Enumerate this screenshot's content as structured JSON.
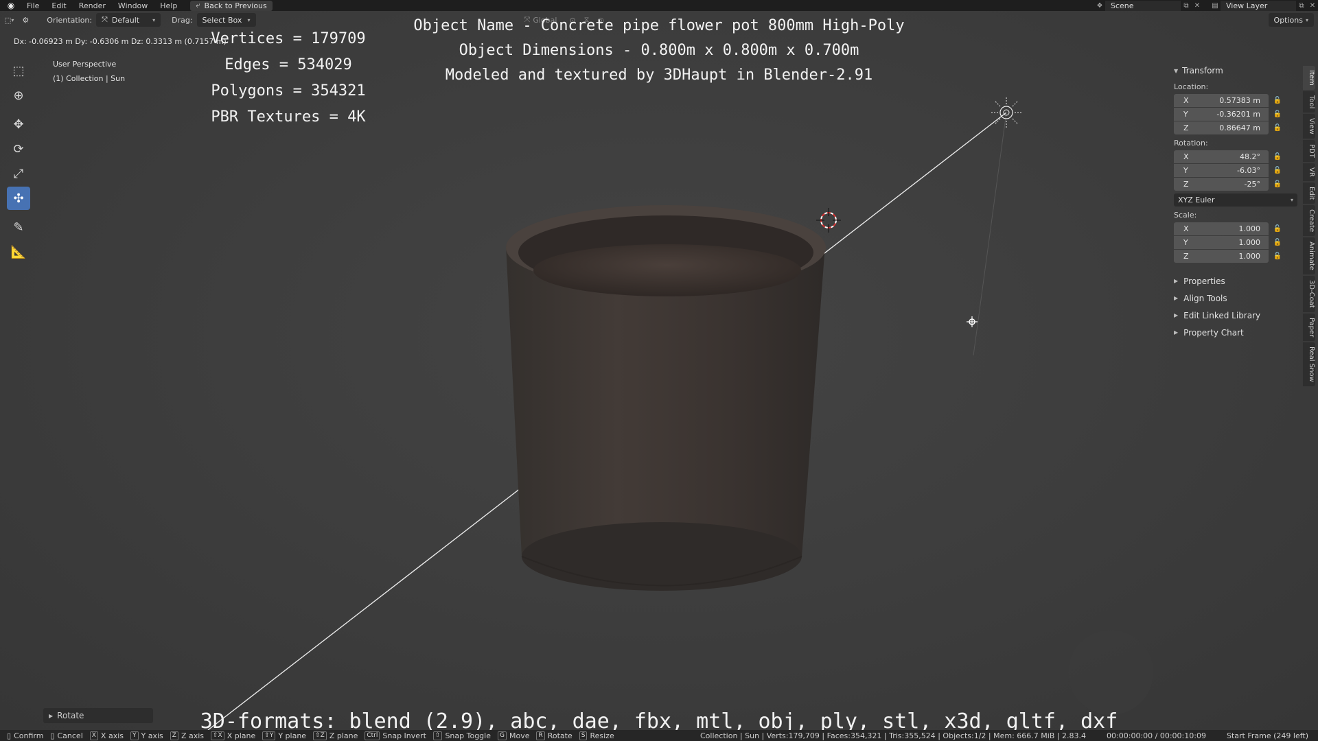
{
  "menubar": {
    "items": [
      "File",
      "Edit",
      "Render",
      "Window",
      "Help"
    ],
    "back_label": "Back to Previous",
    "scene_label": "Scene",
    "view_layer_label": "View Layer"
  },
  "viewport_header": {
    "orientation_label": "Orientation:",
    "orientation_value": "Default",
    "drag_label": "Drag:",
    "drag_value": "Select Box",
    "transform_orientation": "Global",
    "options_label": "Options"
  },
  "delta_text": "Dx: -0.06923 m  Dy: -0.6306 m  Dz: 0.3313 m (0.7157 m)",
  "perspective": {
    "view": "User Perspective",
    "collection": "(1) Collection | Sun"
  },
  "overlay": {
    "stats": [
      "Vertices = 179709",
      "Edges = 534029",
      "Polygons = 354321",
      "PBR Textures = 4K"
    ],
    "title_lines": [
      "Object Name - Concrete pipe flower pot 800mm High-Poly",
      "Object Dimensions -  0.800m x 0.800m x 0.700m",
      "Modeled and textured by 3DHaupt in Blender-2.91"
    ],
    "formats": "3D-formats: blend (2.9), abc, dae, fbx, mtl, obj, ply, stl, x3d, gltf, dxf"
  },
  "rotate_panel_label": "Rotate",
  "npanel": {
    "transform_title": "Transform",
    "location_label": "Location:",
    "location": [
      {
        "axis": "X",
        "value": "0.57383 m"
      },
      {
        "axis": "Y",
        "value": "-0.36201 m"
      },
      {
        "axis": "Z",
        "value": "0.86647 m"
      }
    ],
    "rotation_label": "Rotation:",
    "rotation": [
      {
        "axis": "X",
        "value": "48.2°"
      },
      {
        "axis": "Y",
        "value": "-6.03°"
      },
      {
        "axis": "Z",
        "value": "-25°"
      }
    ],
    "rotation_mode": "XYZ Euler",
    "scale_label": "Scale:",
    "scale": [
      {
        "axis": "X",
        "value": "1.000"
      },
      {
        "axis": "Y",
        "value": "1.000"
      },
      {
        "axis": "Z",
        "value": "1.000"
      }
    ],
    "sections": [
      "Properties",
      "Align Tools",
      "Edit Linked Library",
      "Property Chart"
    ]
  },
  "sidetabs": [
    "Item",
    "Tool",
    "View",
    "PDT",
    "VR",
    "Edit",
    "Create",
    "Animate",
    "3D-Coat",
    "Paper",
    "Real Snow"
  ],
  "statusbar": {
    "items": [
      {
        "key": "",
        "label": "Confirm"
      },
      {
        "key": "",
        "label": "Cancel"
      },
      {
        "key": "X",
        "label": "X axis"
      },
      {
        "key": "Y",
        "label": "Y axis"
      },
      {
        "key": "Z",
        "label": "Z axis"
      },
      {
        "key": "⇧X",
        "label": "X plane"
      },
      {
        "key": "⇧Y",
        "label": "Y plane"
      },
      {
        "key": "⇧Z",
        "label": "Z plane"
      },
      {
        "key": "Ctrl",
        "label": "Snap Invert"
      },
      {
        "key": "⇧",
        "label": "Snap Toggle"
      },
      {
        "key": "G",
        "label": "Move"
      },
      {
        "key": "R",
        "label": "Rotate"
      },
      {
        "key": "S",
        "label": "Resize"
      }
    ],
    "stats": "Collection | Sun | Verts:179,709 | Faces:354,321 | Tris:355,524 | Objects:1/2 | Mem: 666.7 MiB | 2.83.4",
    "time": "00:00:00:00 / 00:00:10:09",
    "frame": "Start Frame (249 left)"
  },
  "colors": {
    "accent": "#4772b3",
    "viewport_bg": "#3f3f3f",
    "pot": "#3f3835"
  }
}
